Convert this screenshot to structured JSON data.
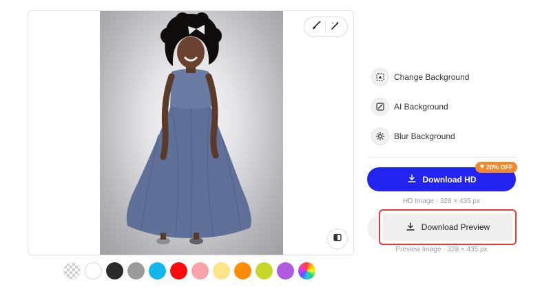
{
  "canvas": {
    "tools": {
      "brush_icon": "brush-icon",
      "magic_icon": "magic-wand-icon"
    },
    "compare_icon": "compare-icon"
  },
  "swatches": [
    {
      "name": "transparent",
      "color": "transparent"
    },
    {
      "name": "white",
      "color": "#ffffff"
    },
    {
      "name": "black",
      "color": "#2a2a2a"
    },
    {
      "name": "gray",
      "color": "#9b9b9b"
    },
    {
      "name": "sky-blue",
      "color": "#12b8ec"
    },
    {
      "name": "red",
      "color": "#ff0a0a"
    },
    {
      "name": "pink",
      "color": "#f7a3a8"
    },
    {
      "name": "light-yellow",
      "color": "#fde48a"
    },
    {
      "name": "orange",
      "color": "#ff8c08"
    },
    {
      "name": "lime",
      "color": "#c6d62c"
    },
    {
      "name": "purple",
      "color": "#b05ae0"
    },
    {
      "name": "custom",
      "color": "rainbow"
    }
  ],
  "options": {
    "change_background": "Change Background",
    "ai_background": "AI Background",
    "blur_background": "Blur Background"
  },
  "download": {
    "hd_label": "Download HD",
    "badge": "20% OFF",
    "hd_meta": "HD Image · 328 × 435 px",
    "preview_label": "Download Preview",
    "preview_meta": "Preview Image · 328 × 435 px",
    "accent_color": "#2323f0",
    "badge_color": "#f08a2c",
    "highlight_color": "#e63a3a"
  }
}
